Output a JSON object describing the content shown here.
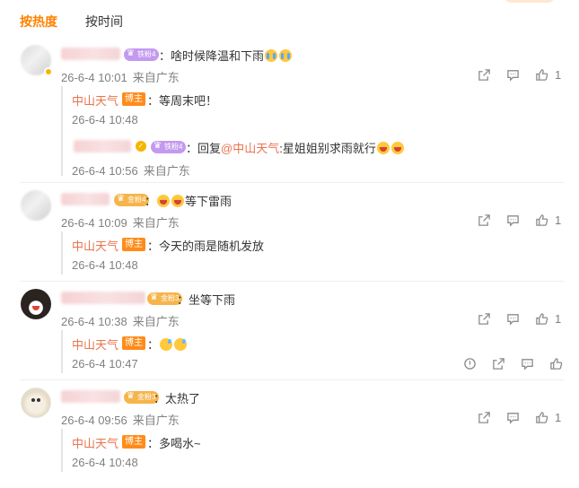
{
  "tabs": {
    "hot": "按热度",
    "time": "按时间"
  },
  "comments": [
    {
      "badge": "铁粉4",
      "text": "：啥时候降温和下雨",
      "time": "26-6-4 10:01",
      "source": "来自广东",
      "likes": "1",
      "replies": [
        {
          "author": "中山天气",
          "badge": "博主",
          "text": "：等周末吧！",
          "time": "26-6-4 10:48",
          "source": ""
        },
        {
          "badge": "铁粉4",
          "prefix": "：回复",
          "mention": "@中山天气",
          "text": ":星姐姐别求雨就行",
          "time": "26-6-4 10:56",
          "source": "来自广东"
        }
      ]
    },
    {
      "badge": "金粉4",
      "text": "等下雷雨",
      "colon": "：",
      "time": "26-6-4 10:09",
      "source": "来自广东",
      "likes": "1",
      "replies": [
        {
          "author": "中山天气",
          "badge": "博主",
          "text": "：今天的雨是随机发放",
          "time": "26-6-4 10:48",
          "source": ""
        }
      ]
    },
    {
      "badge": "金粉3",
      "text": "：坐等下雨",
      "time": "26-6-4 10:38",
      "source": "来自广东",
      "likes": "1",
      "replies": [
        {
          "author": "中山天气",
          "badge": "博主",
          "colon": "：",
          "time": "26-6-4 10:47",
          "source": ""
        }
      ]
    },
    {
      "badge": "金粉3",
      "text": "：太热了",
      "time": "26-6-4 09:56",
      "source": "来自广东",
      "likes": "1",
      "replies": [
        {
          "author": "中山天气",
          "badge": "博主",
          "text": "：多喝水~",
          "time": "26-6-4 10:48",
          "source": ""
        }
      ]
    }
  ],
  "icons": [
    "share-icon",
    "comment-icon",
    "like-icon",
    "report-icon"
  ],
  "colors": {
    "accent": "#ff8200",
    "author": "#eb7350",
    "meta": "#808080"
  }
}
